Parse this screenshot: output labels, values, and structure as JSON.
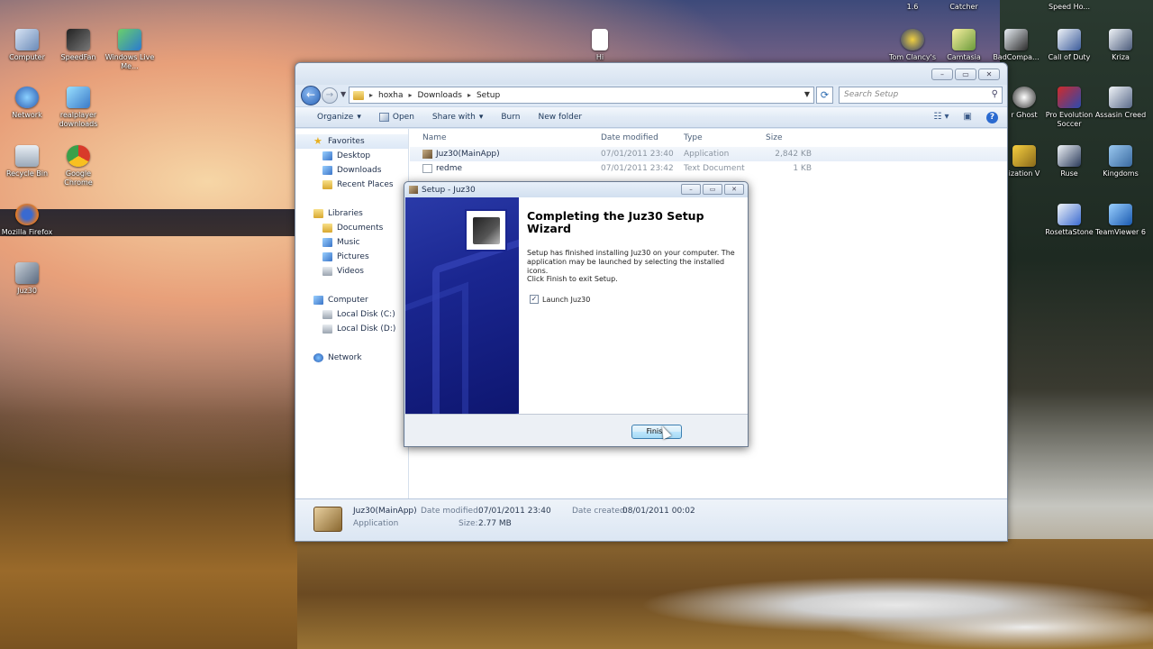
{
  "desktop": {
    "icons_left": [
      {
        "label": "Computer",
        "icon": "computer-icon"
      },
      {
        "label": "SpeedFan",
        "icon": "speedfan-icon"
      },
      {
        "label": "Windows Live Me...",
        "icon": "windows-live-icon"
      },
      {
        "label": "Network",
        "icon": "network-icon"
      },
      {
        "label": "realplayer downloads",
        "icon": "realplayer-icon"
      },
      {
        "label": "Recycle Bin",
        "icon": "recycle-bin-icon"
      },
      {
        "label": "Google Chrome",
        "icon": "chrome-icon"
      },
      {
        "label": "Mozilla Firefox",
        "icon": "firefox-icon"
      },
      {
        "label": "Juz30",
        "icon": "juz30-icon"
      },
      {
        "label": "Hi",
        "icon": "text-file-icon"
      }
    ],
    "icons_right": [
      {
        "label": "Tom Clancy's",
        "icon": "game-icon"
      },
      {
        "label": "Camtasia",
        "icon": "camtasia-icon"
      },
      {
        "label": "BadCompa...",
        "icon": "game-icon"
      },
      {
        "label": "Call of Duty",
        "icon": "game-icon"
      },
      {
        "label": "Kriza",
        "icon": "game-icon"
      },
      {
        "label": "r Ghost",
        "icon": "game-icon"
      },
      {
        "label": "Pro Evolution Soccer",
        "icon": "game-icon"
      },
      {
        "label": "Assasin Creed",
        "icon": "game-icon"
      },
      {
        "label": "ization V",
        "icon": "game-icon"
      },
      {
        "label": "Ruse",
        "icon": "game-icon"
      },
      {
        "label": "Kingdoms",
        "icon": "game-icon"
      },
      {
        "label": "RosettaStone",
        "icon": "rosetta-icon"
      },
      {
        "label": "TeamViewer 6",
        "icon": "teamviewer-icon"
      }
    ],
    "top_cut_labels": [
      "Catcher",
      "Speed Ho...",
      "1.6"
    ]
  },
  "explorer": {
    "breadcrumb": [
      "hoxha",
      "Downloads",
      "Setup"
    ],
    "search_placeholder": "Search Setup",
    "toolbar": {
      "organize": "Organize",
      "open": "Open",
      "share_with": "Share with",
      "burn": "Burn",
      "new_folder": "New folder"
    },
    "nav": {
      "favorites": "Favorites",
      "desktop": "Desktop",
      "downloads": "Downloads",
      "recent_places": "Recent Places",
      "libraries": "Libraries",
      "documents": "Documents",
      "music": "Music",
      "pictures": "Pictures",
      "videos": "Videos",
      "computer": "Computer",
      "local_c": "Local Disk (C:)",
      "local_d": "Local Disk (D:)",
      "network": "Network"
    },
    "columns": {
      "name": "Name",
      "date": "Date modified",
      "type": "Type",
      "size": "Size"
    },
    "files": [
      {
        "name": "Juz30(MainApp)",
        "date": "07/01/2011 23:40",
        "type": "Application",
        "size": "2,842 KB"
      },
      {
        "name": "redme",
        "date": "07/01/2011 23:42",
        "type": "Text Document",
        "size": "1 KB"
      }
    ],
    "details": {
      "name": "Juz30(MainApp)",
      "kind": "Application",
      "date_modified_label": "Date modified:",
      "date_modified": "07/01/2011 23:40",
      "size_label": "Size:",
      "size": "2.77 MB",
      "date_created_label": "Date created:",
      "date_created": "08/01/2011 00:02"
    }
  },
  "setup": {
    "title": "Setup - Juz30",
    "heading": "Completing the Juz30 Setup Wizard",
    "text": "Setup has finished installing Juz30 on your computer. The application may be launched by selecting the installed icons.",
    "text2": "Click Finish to exit Setup.",
    "launch_label": "Launch Juz30",
    "launch_checked": true,
    "finish_label": "Finish"
  }
}
